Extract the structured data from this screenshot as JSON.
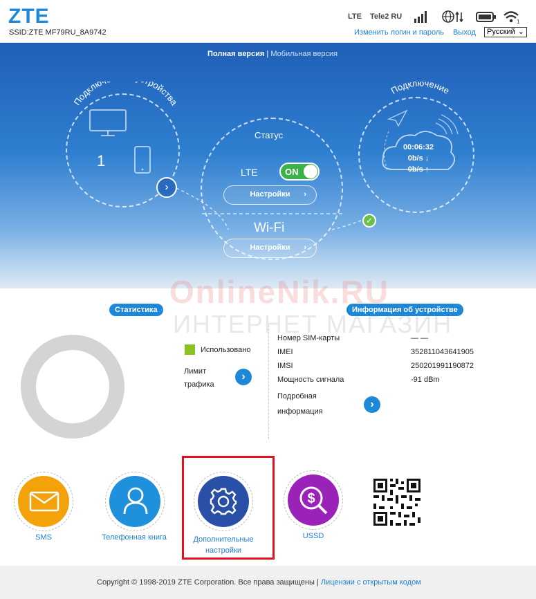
{
  "header": {
    "logo": "ZTE",
    "ssid": "SSID:ZTE MF79RU_8A9742",
    "network_type": "LTE",
    "operator": "Tele2 RU",
    "change_login": "Изменить логин и пароль",
    "logout": "Выход",
    "language": "Русский"
  },
  "version": {
    "full": "Полная версия",
    "sep": " | ",
    "mobile": "Мобильная версия"
  },
  "devices": {
    "title": "Подключенные устройства",
    "count": "1"
  },
  "status": {
    "title": "Статус",
    "lte_label": "LTE",
    "toggle": "ON",
    "settings1": "Настройки",
    "wifi_label": "Wi-Fi",
    "settings2": "Настройки"
  },
  "connection": {
    "title": "Подключение",
    "time": "00:06:32",
    "down": "0b/s ↓",
    "up": "0b/s ↑"
  },
  "watermark": {
    "line1": "OnlineNik.RU",
    "line2": "ИНТЕРНЕТ МАГАЗИН"
  },
  "stats": {
    "title": "Статистика",
    "used_label": "Использовано",
    "limit_line1": "Лимит",
    "limit_line2": "трафика",
    "used_fraction": 0,
    "used_color": "#8cc21f"
  },
  "device_info": {
    "title": "Информация об устройстве",
    "rows": [
      {
        "label": "Номер SIM-карты",
        "value": "— —"
      },
      {
        "label": "IMEI",
        "value": "352811043641905"
      },
      {
        "label": "IMSI",
        "value": "250201991190872"
      },
      {
        "label": "Мощность сигнала",
        "value": "-91 dBm"
      }
    ],
    "more_line1": "Подробная",
    "more_line2": "информация"
  },
  "apps": [
    {
      "label": "SMS",
      "icon": "envelope-icon",
      "color": "#f4a20a"
    },
    {
      "label": "Телефонная книга",
      "icon": "person-icon",
      "color": "#1e90dc"
    },
    {
      "label_line1": "Дополнительные",
      "label_line2": "настройки",
      "icon": "gear-icon",
      "color": "#2a4fa6"
    },
    {
      "label": "USSD",
      "icon": "dollar-search-icon",
      "color": "#9b22b8"
    }
  ],
  "footer": {
    "copyright": "Copyright © 1998-2019 ZTE Corporation. Все права защищены",
    "sep": " | ",
    "licenses": "Лицензии с открытым кодом"
  }
}
